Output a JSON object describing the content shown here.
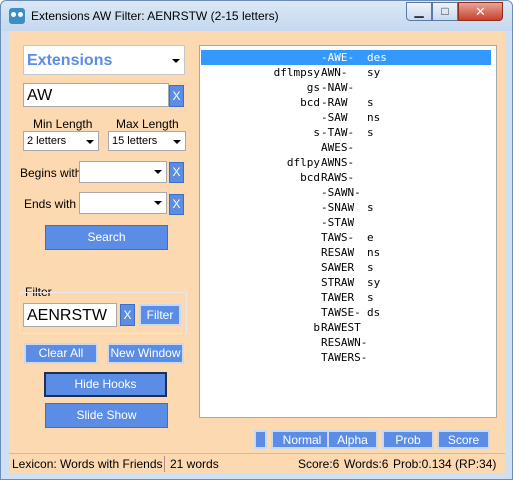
{
  "window": {
    "title": "Extensions AW Filter: AENRSTW (2-15 letters)",
    "minimize_glyph": "▁",
    "maximize_glyph": "□",
    "close_glyph": "✕"
  },
  "search": {
    "mode": "Extensions",
    "word": "AW",
    "clear_label": "X",
    "min_length_label": "Min Length",
    "min_length_value": "2 letters",
    "max_length_label": "Max Length",
    "max_length_value": "15 letters",
    "begins_with_label": "Begins with",
    "begins_with_value": "",
    "ends_with_label": "Ends with",
    "ends_with_value": "",
    "search_label": "Search"
  },
  "filter": {
    "group_label": "Filter",
    "value": "AENRSTW",
    "clear_label": "X",
    "button_label": "Filter"
  },
  "actions": {
    "clear_all": "Clear All",
    "new_window": "New Window",
    "hide_hooks": "Hide Hooks",
    "slide_show": "Slide Show"
  },
  "results": [
    {
      "front": "",
      "word": "-AWE-",
      "back": "des",
      "selected": true
    },
    {
      "front": "dflmpsy",
      "word": "AWN-",
      "back": "sy"
    },
    {
      "front": "gs",
      "word": "-NAW-",
      "back": ""
    },
    {
      "front": "bcd",
      "word": "-RAW",
      "back": "s"
    },
    {
      "front": "",
      "word": "-SAW",
      "back": "ns"
    },
    {
      "front": "s",
      "word": "-TAW-",
      "back": "s"
    },
    {
      "front": "",
      "word": "AWES-",
      "back": ""
    },
    {
      "front": "dflpy",
      "word": "AWNS-",
      "back": ""
    },
    {
      "front": "bcd",
      "word": "RAWS-",
      "back": ""
    },
    {
      "front": "",
      "word": "-SAWN-",
      "back": ""
    },
    {
      "front": "",
      "word": "-SNAW",
      "back": "s"
    },
    {
      "front": "",
      "word": "-STAW",
      "back": ""
    },
    {
      "front": "",
      "word": "TAWS-",
      "back": "e"
    },
    {
      "front": "",
      "word": "RESAW",
      "back": "ns"
    },
    {
      "front": "",
      "word": "SAWER",
      "back": "s"
    },
    {
      "front": "",
      "word": "STRAW",
      "back": "sy"
    },
    {
      "front": "",
      "word": "TAWER",
      "back": "s"
    },
    {
      "front": "",
      "word": "TAWSE-",
      "back": "ds"
    },
    {
      "front": "b",
      "word": "RAWEST",
      "back": ""
    },
    {
      "front": "",
      "word": "RESAWN-",
      "back": ""
    },
    {
      "front": "",
      "word": "TAWERS-",
      "back": ""
    }
  ],
  "sort_buttons": {
    "blank": "",
    "normal": "Normal",
    "alpha": "Alpha",
    "prob": "Prob",
    "score": "Score"
  },
  "status": {
    "lexicon": "Lexicon: Words with Friends",
    "count": "21 words",
    "score": "Score:6",
    "words": "Words:6",
    "prob": "Prob:0.134 (RP:34)"
  },
  "colors": {
    "panel_background": "#fdd9b2",
    "button_blue": "#5b8de6",
    "selection": "#3399ff"
  }
}
